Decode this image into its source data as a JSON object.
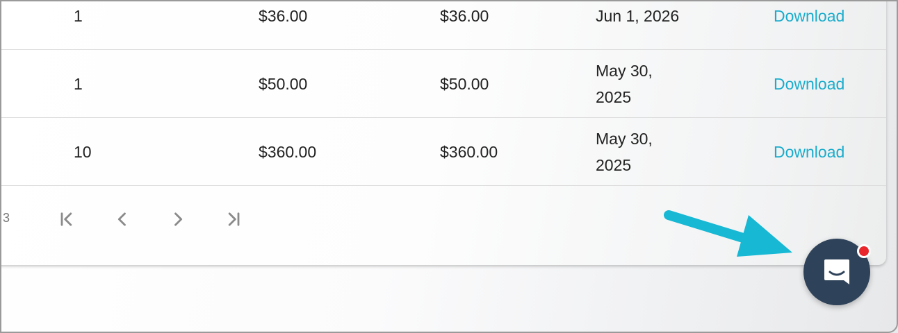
{
  "table": {
    "rows": [
      {
        "qty": "1",
        "unit_price": "$36.00",
        "total": "$36.00",
        "date": "Jun 1, 2026",
        "action": "Download"
      },
      {
        "qty": "1",
        "unit_price": "$50.00",
        "total": "$50.00",
        "date": "May 30, 2025",
        "action": "Download"
      },
      {
        "qty": "10",
        "unit_price": "$360.00",
        "total": "$360.00",
        "date": "May 30, 2025",
        "action": "Download"
      }
    ]
  },
  "pagination": {
    "count_fragment": "3"
  },
  "icons": {
    "first": "first-page-icon",
    "prev": "chevron-left-icon",
    "next": "chevron-right-icon",
    "last": "last-page-icon",
    "chat": "chat-bubble-icon",
    "annotation": "pointer-arrow"
  },
  "colors": {
    "link": "#1aaccc",
    "chat_bg": "#2e4259",
    "badge": "#e8262c",
    "arrow": "#16b8d4",
    "pager_icon": "#8a8a8a"
  }
}
